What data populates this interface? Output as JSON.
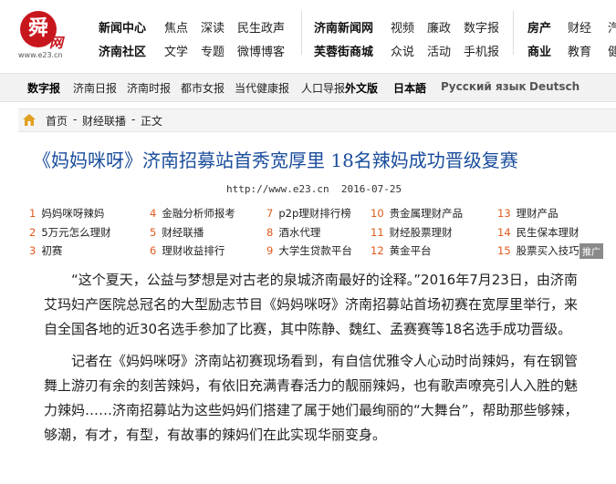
{
  "logo": {
    "glyph": "舜",
    "suffix": "网",
    "url": "www.e23.cn"
  },
  "nav": {
    "group1": {
      "row1": [
        "新闻中心",
        "焦点",
        "深读",
        "民生政声"
      ],
      "row2": [
        "济南社区",
        "文学",
        "专题",
        "微博博客"
      ]
    },
    "group2": {
      "row1": [
        "济南新闻网",
        "视频",
        "廉政",
        "数字报"
      ],
      "row2": [
        "芙蓉街商城",
        "众说",
        "活动",
        "手机报"
      ]
    },
    "group3": {
      "row1": [
        "房产",
        "财经",
        "汽"
      ],
      "row2": [
        "商业",
        "教育",
        "健"
      ]
    }
  },
  "papers": [
    "数字报",
    "济南日报",
    "济南时报",
    "都市女报",
    "当代健康报",
    "人口导报",
    "外文版",
    "日本語",
    "Русский язык",
    "Deutsch"
  ],
  "breadcrumb": {
    "home": "首页",
    "sep1": "-",
    "section": "财经联播",
    "sep2": "-",
    "current": "正文"
  },
  "article": {
    "title": "《妈妈咪呀》济南招募站首秀宽厚里  18名辣妈成功晋级复赛",
    "url": "http://www.e23.cn",
    "date": "2016-07-25",
    "paragraphs": [
      "“这个夏天，公益与梦想是对古老的泉城济南最好的诠释。”2016年7月23日，由济南艾玛妇产医院总冠名的大型励志节目《妈妈咪呀》济南招募站首场初赛在宽厚里举行，来自全国各地的近30名选手参加了比赛，其中陈静、魏红、孟赛赛等18名选手成功晋级。",
      "记者在《妈妈咪呀》济南站初赛现场看到，有自信优雅令人心动时尚辣妈，有在钢管舞上游刃有余的刻苦辣妈，有依旧充满青春活力的靓丽辣妈，也有歌声嘹亮引人入胜的魅力辣妈……济南招募站为这些妈妈们搭建了属于她们最绚丽的“大舞台”，帮助那些够辣，够潮，有才，有型，有故事的辣妈们在此实现华丽变身。"
    ]
  },
  "links": [
    {
      "num": "1",
      "text": "妈妈咪呀辣妈"
    },
    {
      "num": "4",
      "text": "金融分析师报考"
    },
    {
      "num": "7",
      "text": "p2p理财排行榜"
    },
    {
      "num": "10",
      "text": "贵金属理财产品"
    },
    {
      "num": "13",
      "text": "理财产品"
    },
    {
      "num": "2",
      "text": "5万元怎么理财"
    },
    {
      "num": "5",
      "text": "财经联播"
    },
    {
      "num": "8",
      "text": "酒水代理"
    },
    {
      "num": "11",
      "text": "财经股票理财"
    },
    {
      "num": "14",
      "text": "民生保本理财"
    },
    {
      "num": "3",
      "text": "初赛"
    },
    {
      "num": "6",
      "text": "理财收益排行"
    },
    {
      "num": "9",
      "text": "大学生贷款平台"
    },
    {
      "num": "12",
      "text": "黄金平台"
    },
    {
      "num": "15",
      "text": "股票买入技巧"
    }
  ],
  "ad_label": "推广",
  "colors": {
    "brand_red": "#c8161d",
    "title_blue": "#1a4d9c",
    "link_num_orange": "#e05a1c"
  },
  "icons": {
    "breadcrumb": "house-icon"
  }
}
